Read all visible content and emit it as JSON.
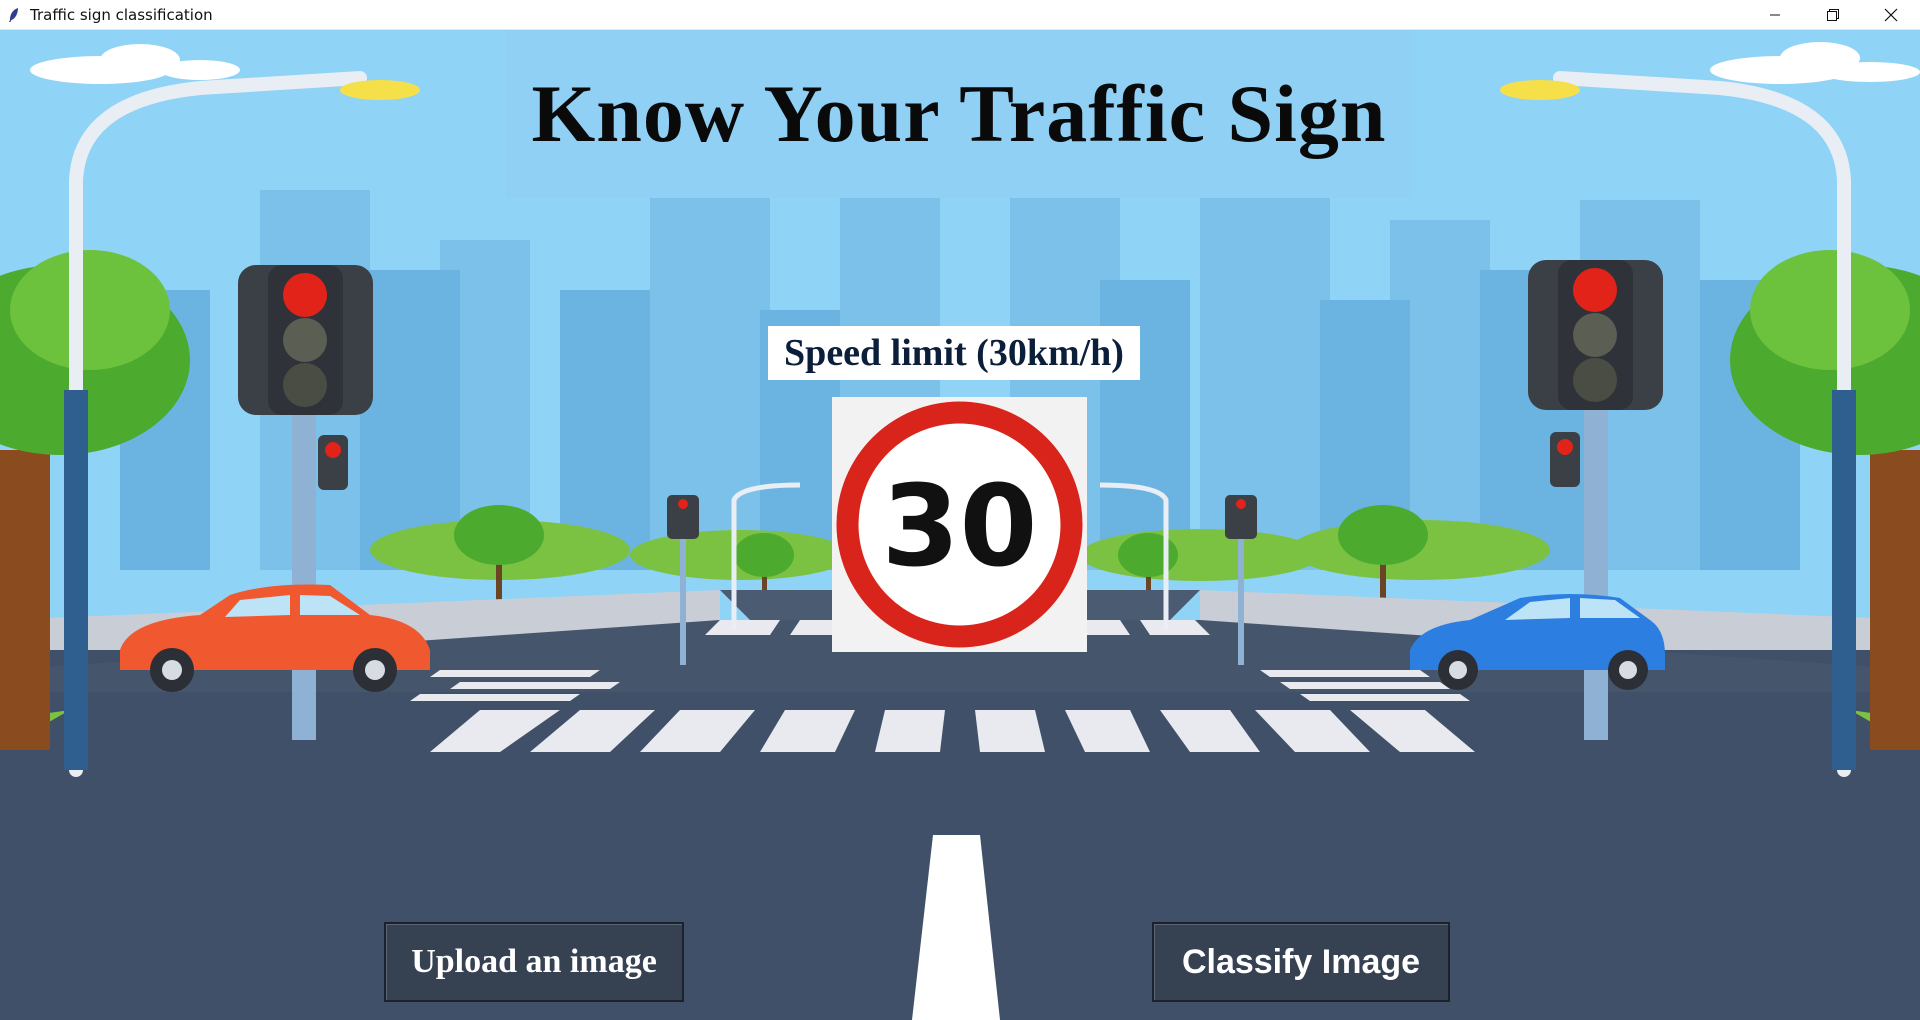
{
  "window": {
    "title": "Traffic sign classification",
    "icon": "feather-icon",
    "controls": [
      "minimize-icon",
      "restore-icon",
      "close-icon"
    ]
  },
  "header": {
    "title": "Know Your Traffic Sign"
  },
  "result": {
    "label": "Speed limit (30km/h)",
    "sign_number": "30"
  },
  "buttons": {
    "upload_label": "Upload an image",
    "classify_label": "Classify Image"
  },
  "colors": {
    "sky": "#8fd3f7",
    "road": "#3f5068",
    "button_bg": "#364152",
    "sign_ring": "#d9241c"
  }
}
